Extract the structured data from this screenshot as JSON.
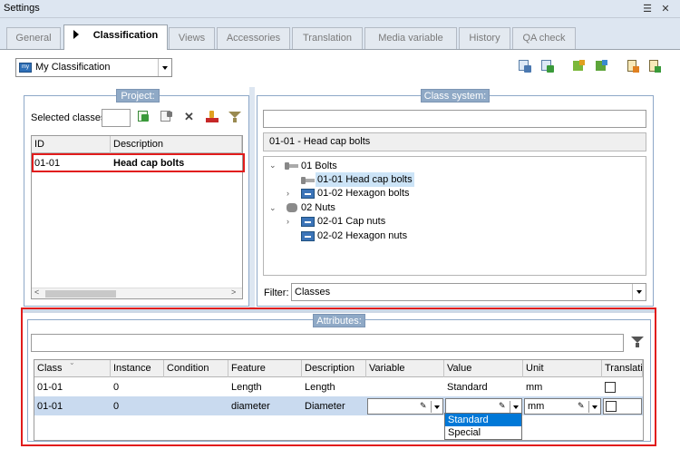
{
  "window": {
    "title": "Settings"
  },
  "tabs": [
    {
      "label": "General"
    },
    {
      "label": "Classification"
    },
    {
      "label": "Views"
    },
    {
      "label": "Accessories"
    },
    {
      "label": "Translation"
    },
    {
      "label": "Media variable"
    },
    {
      "label": "History"
    },
    {
      "label": "QA check"
    }
  ],
  "classification_select": {
    "icon_text": "my",
    "value": "My Classification"
  },
  "project": {
    "section_label": "Project:",
    "selected_classes_label": "Selected classes",
    "columns": [
      "ID",
      "Description"
    ],
    "rows": [
      {
        "id": "01-01",
        "description": "Head cap bolts"
      }
    ]
  },
  "class_system": {
    "section_label": "Class system:",
    "search_value": "",
    "current_path": "01-01 - Head cap bolts",
    "tree": [
      {
        "label": "01 Bolts"
      },
      {
        "label": "01-01 Head cap bolts"
      },
      {
        "label": "01-02 Hexagon bolts"
      },
      {
        "label": "02 Nuts"
      },
      {
        "label": "02-01 Cap nuts"
      },
      {
        "label": "02-02 Hexagon nuts"
      }
    ],
    "filter_label": "Filter:",
    "filter_value": "Classes"
  },
  "attributes": {
    "section_label": "Attributes:",
    "search_value": "",
    "columns": [
      "Class",
      "Instance",
      "Condition",
      "Feature",
      "Description",
      "Variable",
      "Value",
      "Unit",
      "Translati"
    ],
    "rows": [
      {
        "class": "01-01",
        "instance": "0",
        "condition": "",
        "feature": "Length",
        "description": "Length",
        "variable": "",
        "value": "Standard",
        "unit": "mm"
      },
      {
        "class": "01-01",
        "instance": "0",
        "condition": "",
        "feature": "diameter",
        "description": "Diameter",
        "variable": "",
        "value": "",
        "unit": "mm"
      }
    ],
    "value_dropdown_options": [
      "Standard",
      "Special"
    ]
  },
  "colors": {
    "highlight_red": "#e11c1c",
    "section_header": "#8fa9c6",
    "selection": "#0078d7"
  }
}
